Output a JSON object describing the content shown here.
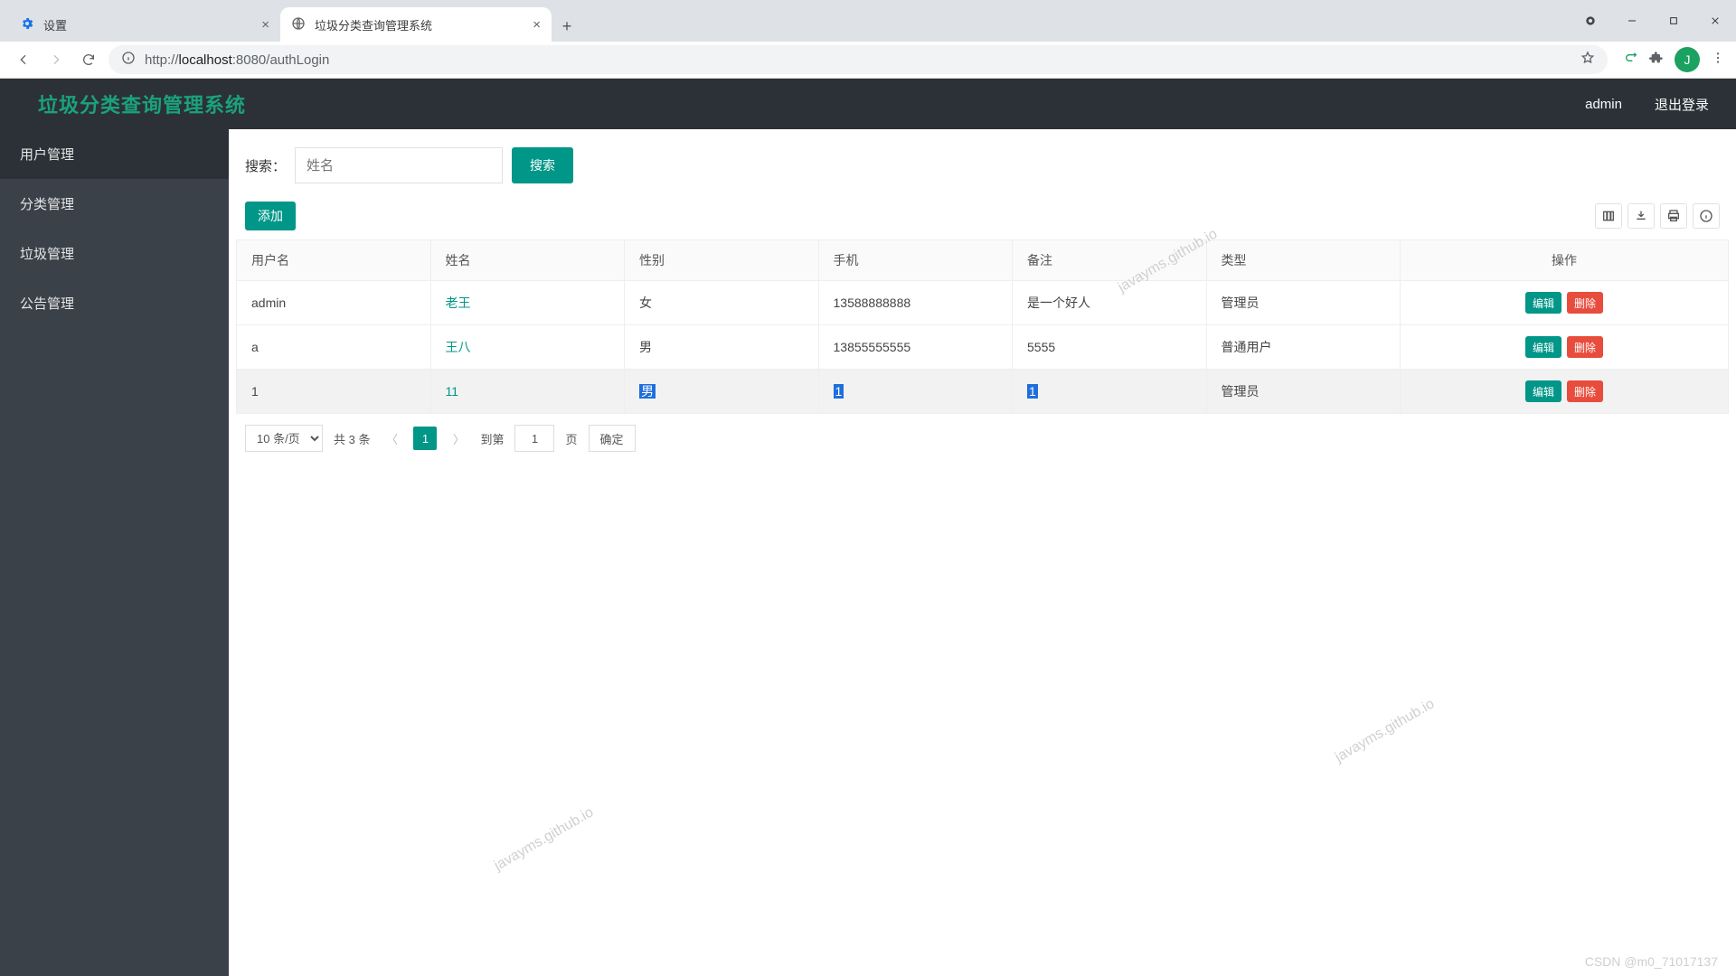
{
  "browser": {
    "tabs": [
      {
        "title": "设置"
      },
      {
        "title": "垃圾分类查询管理系统"
      }
    ],
    "url_prefix": "http://",
    "url_host": "localhost",
    "url_rest": ":8080/authLogin",
    "avatar_letter": "J"
  },
  "header": {
    "title": "垃圾分类查询管理系统",
    "username": "admin",
    "logout": "退出登录"
  },
  "sidebar": {
    "items": [
      "用户管理",
      "分类管理",
      "垃圾管理",
      "公告管理"
    ]
  },
  "search": {
    "label": "搜索：",
    "placeholder": "姓名",
    "button": "搜索"
  },
  "toolbar": {
    "add": "添加"
  },
  "table": {
    "headers": [
      "用户名",
      "姓名",
      "性别",
      "手机",
      "备注",
      "类型",
      "操作"
    ],
    "rows": [
      {
        "username": "admin",
        "name": "老王",
        "gender": "女",
        "phone": "13588888888",
        "remark": "是一个好人",
        "type": "管理员",
        "hl": false
      },
      {
        "username": "a",
        "name": "王八",
        "gender": "男",
        "phone": "13855555555",
        "remark": "5555",
        "type": "普通用户",
        "hl": false
      },
      {
        "username": "1",
        "name": "11",
        "gender": "男",
        "phone": "1",
        "remark": "1",
        "type": "管理员",
        "hl": true
      }
    ],
    "ops": {
      "edit": "编辑",
      "delete": "删除"
    }
  },
  "pager": {
    "size": "10 条/页",
    "total": "共 3 条",
    "current": "1",
    "goto_label": "到第",
    "goto_value": "1",
    "page_suffix": "页",
    "confirm": "确定"
  },
  "watermarks": [
    "javayms.github.io",
    "javayms.github.io",
    "javayms.github.io"
  ],
  "credit": "CSDN @m0_71017137"
}
